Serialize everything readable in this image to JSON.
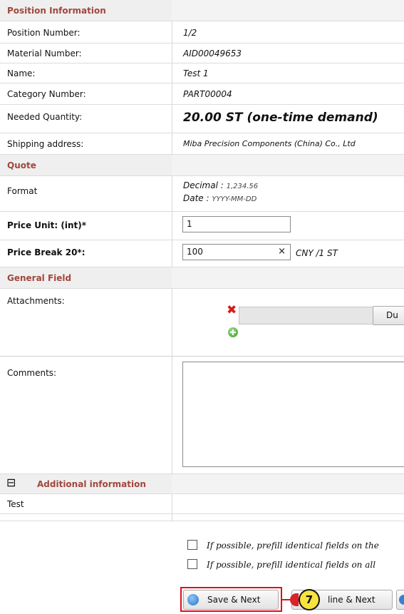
{
  "position_section": {
    "title": "Position Information",
    "rows": [
      {
        "label": "Position Number:",
        "value": "1/2"
      },
      {
        "label": "Material Number:",
        "value": "AID00049653"
      },
      {
        "label": "Name:",
        "value": "Test 1"
      },
      {
        "label": "Category Number:",
        "value": "PART00004"
      },
      {
        "label": "Needed Quantity:",
        "value": "20.00 ST (one-time demand)"
      },
      {
        "label": "Shipping address:",
        "value": "Miba Precision Components (China) Co., Ltd"
      }
    ]
  },
  "quote_section": {
    "title": "Quote",
    "format_label": "Format",
    "decimal_label": "Decimal :",
    "decimal_example": "1,234.56",
    "date_label": "Date :",
    "date_example": "YYYY-MM-DD",
    "price_unit_label": "Price Unit: (int)*",
    "price_unit_value": "1",
    "price_break_label": "Price Break 20*:",
    "price_break_value": "100",
    "price_break_clear": "×",
    "price_break_unit": "CNY /1 ST"
  },
  "general_section": {
    "title": "General Field",
    "attachments_label": "Attachments:",
    "attach_button": "Du",
    "comments_label": "Comments:",
    "comments_value": ""
  },
  "additional_section": {
    "toggle": "⊟",
    "title": "Additional information",
    "test_label": "Test"
  },
  "options": {
    "prefill_same": "If possible, prefill identical fields on the",
    "prefill_all": "If possible, prefill identical fields on all"
  },
  "buttons": {
    "save_next": "Save & Next",
    "decline_next": "line & Next",
    "callout_number": "7"
  },
  "colors": {
    "section_title": "#a0473d",
    "highlight": "#e0101c",
    "callout": "#f6e33e"
  }
}
